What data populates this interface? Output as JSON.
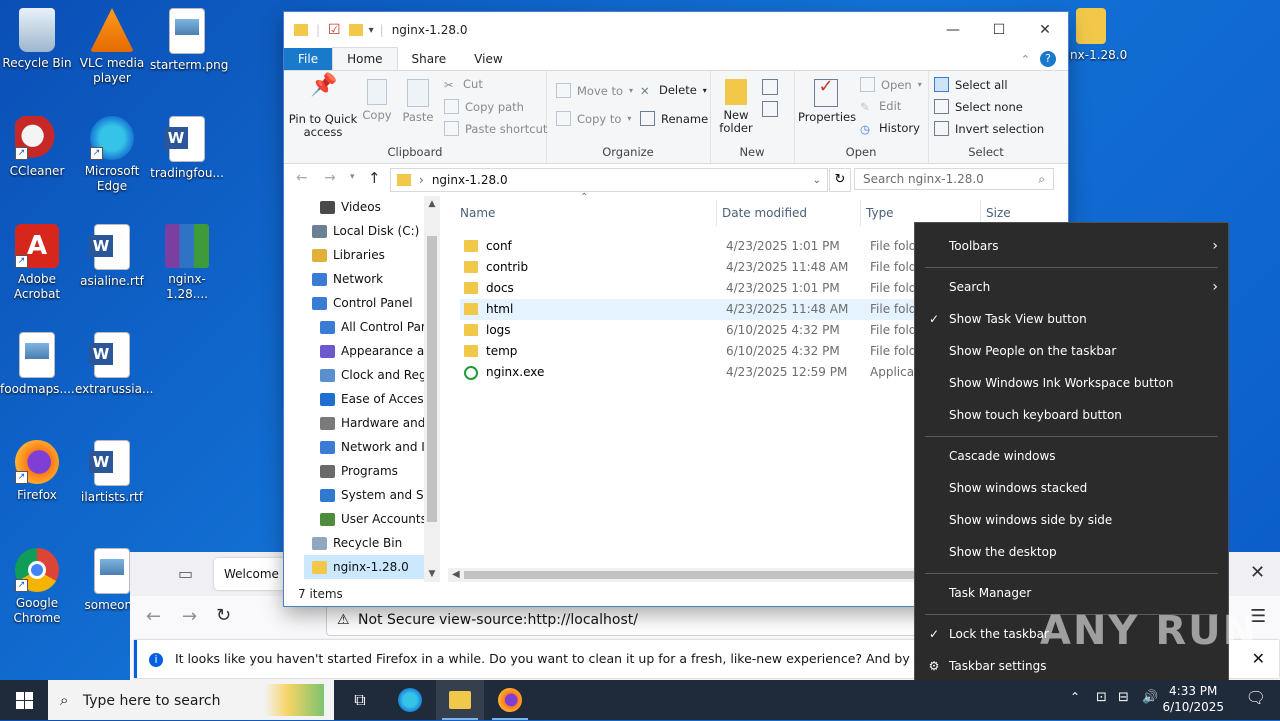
{
  "desktop": {
    "icons": [
      {
        "label": "Recycle Bin"
      },
      {
        "label": "VLC media player"
      },
      {
        "label": "starterm.png"
      },
      {
        "label": "CCleaner"
      },
      {
        "label": "Microsoft Edge"
      },
      {
        "label": "tradingfou..."
      },
      {
        "label": "Adobe Acrobat"
      },
      {
        "label": "asialine.rtf"
      },
      {
        "label": "nginx-1.28...."
      },
      {
        "label": "foodmaps...."
      },
      {
        "label": "extrarussia..."
      },
      {
        "label": "Firefox"
      },
      {
        "label": "ilartists.rtf"
      },
      {
        "label": "Google Chrome"
      },
      {
        "label": "someone"
      },
      {
        "label": "inx-1.28.0"
      }
    ]
  },
  "explorer": {
    "title": "nginx-1.28.0",
    "tabs": [
      "File",
      "Home",
      "Share",
      "View"
    ],
    "ribbon": {
      "clipboard": {
        "label": "Clipboard",
        "pin": "Pin to Quick access",
        "copy": "Copy",
        "paste": "Paste",
        "cut": "Cut",
        "copy_path": "Copy path",
        "paste_shortcut": "Paste shortcut"
      },
      "organize": {
        "label": "Organize",
        "move_to": "Move to",
        "copy_to": "Copy to",
        "delete": "Delete",
        "rename": "Rename"
      },
      "new": {
        "label": "New",
        "new_folder": "New folder"
      },
      "open": {
        "label": "Open",
        "properties": "Properties",
        "open_btn": "Open",
        "edit": "Edit",
        "history": "History"
      },
      "select": {
        "label": "Select",
        "select_all": "Select all",
        "select_none": "Select none",
        "invert": "Invert selection"
      }
    },
    "address": {
      "path": "nginx-1.28.0",
      "search_placeholder": "Search nginx-1.28.0"
    },
    "nav": [
      {
        "label": "Videos",
        "color": "#4a4a4a"
      },
      {
        "label": "Local Disk (C:)",
        "color": "#6b7f95"
      },
      {
        "label": "Libraries",
        "color": "#e0b03a"
      },
      {
        "label": "Network",
        "color": "#3a7bd5"
      },
      {
        "label": "Control Panel",
        "color": "#3a7bd5"
      },
      {
        "label": "All Control Par",
        "color": "#3a7bd5"
      },
      {
        "label": "Appearance an",
        "color": "#6a5acd"
      },
      {
        "label": "Clock and Regi",
        "color": "#5a8fd0"
      },
      {
        "label": "Ease of Access",
        "color": "#1f6fd1"
      },
      {
        "label": "Hardware and",
        "color": "#7a7a7a"
      },
      {
        "label": "Network and Ir",
        "color": "#3a7bd5"
      },
      {
        "label": "Programs",
        "color": "#6a6a6a"
      },
      {
        "label": "System and Se",
        "color": "#2f7ad0"
      },
      {
        "label": "User Accounts",
        "color": "#4c8c3a"
      },
      {
        "label": "Recycle Bin",
        "color": "#8fa8c0"
      },
      {
        "label": "nginx-1.28.0",
        "color": "#f2c84b"
      }
    ],
    "columns": {
      "name": "Name",
      "date": "Date modified",
      "type": "Type",
      "size": "Size"
    },
    "files": [
      {
        "name": "conf",
        "date": "4/23/2025 1:01 PM",
        "type": "File folde"
      },
      {
        "name": "contrib",
        "date": "4/23/2025 11:48 AM",
        "type": "File folde"
      },
      {
        "name": "docs",
        "date": "4/23/2025 1:01 PM",
        "type": "File folde"
      },
      {
        "name": "html",
        "date": "4/23/2025 11:48 AM",
        "type": "File folde"
      },
      {
        "name": "logs",
        "date": "6/10/2025 4:32 PM",
        "type": "File folde"
      },
      {
        "name": "temp",
        "date": "6/10/2025 4:32 PM",
        "type": "File folde"
      },
      {
        "name": "nginx.exe",
        "date": "4/23/2025 12:59 PM",
        "type": "Applicati"
      }
    ],
    "status": "7 items"
  },
  "firefox": {
    "tab_title": "Welcome to",
    "not_secure": "Not Secure",
    "url": "view-source:http://localhost/",
    "notice": "It looks like you haven't started Firefox in a while. Do you want to clean it up for a fresh, like-new experience? And by the way, welcome back!"
  },
  "context_menu": {
    "items": [
      {
        "label": "Toolbars",
        "check": "",
        "arrow": "›"
      },
      {
        "label": "Search",
        "check": "",
        "arrow": "›"
      },
      {
        "label": "Show Task View button",
        "check": "✓",
        "arrow": ""
      },
      {
        "label": "Show People on the taskbar",
        "check": "",
        "arrow": ""
      },
      {
        "label": "Show Windows Ink Workspace button",
        "check": "",
        "arrow": ""
      },
      {
        "label": "Show touch keyboard button",
        "check": "",
        "arrow": ""
      },
      {
        "label": "Cascade windows",
        "check": "",
        "arrow": ""
      },
      {
        "label": "Show windows stacked",
        "check": "",
        "arrow": ""
      },
      {
        "label": "Show windows side by side",
        "check": "",
        "arrow": ""
      },
      {
        "label": "Show the desktop",
        "check": "",
        "arrow": ""
      },
      {
        "label": "Task Manager",
        "check": "",
        "arrow": ""
      },
      {
        "label": "Lock the taskbar",
        "check": "✓",
        "arrow": ""
      },
      {
        "label": "Taskbar settings",
        "check": "⚙",
        "arrow": ""
      }
    ]
  },
  "taskbar": {
    "search_placeholder": "Type here to search",
    "time": "4:33 PM",
    "date": "6/10/2025"
  },
  "watermark": "ANY RUN"
}
